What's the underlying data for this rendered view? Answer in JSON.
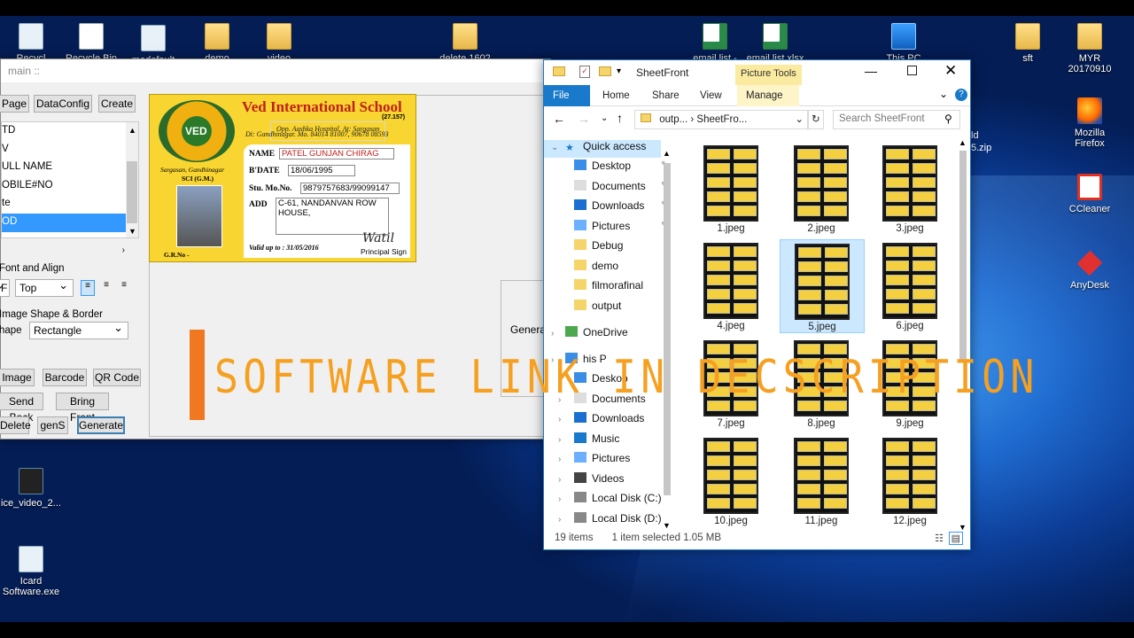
{
  "desktop": {
    "icons": [
      {
        "label": "Recycl",
        "type": "app"
      },
      {
        "label": "Recycle Bin",
        "type": "file"
      },
      {
        "label": "madefault",
        "type": "app"
      },
      {
        "label": "demo",
        "type": "fold"
      },
      {
        "label": "video",
        "type": "fold"
      },
      {
        "label": "delete 1602",
        "type": "fold"
      },
      {
        "label": "email list -",
        "type": "xls"
      },
      {
        "label": "email list.xlsx",
        "type": "xls"
      },
      {
        "label": "This PC",
        "type": "pc"
      },
      {
        "label": "sft",
        "type": "fold"
      },
      {
        "label": "MYR 20170910",
        "type": "fold"
      },
      {
        "label": "Mozilla Firefox",
        "type": "ff"
      },
      {
        "label": "CCleaner",
        "type": "cc"
      },
      {
        "label": "AnyDesk",
        "type": "ad"
      },
      {
        "label": "ice_video_2...",
        "type": "vid"
      },
      {
        "label": "Icard Software.exe",
        "type": "app"
      }
    ],
    "partial_label": "ld 5.zip"
  },
  "app": {
    "title": "main ::",
    "buttons": {
      "page": "Page",
      "dataconfig": "DataConfig",
      "create": "Create",
      "image": "Image",
      "barcode": "Barcode",
      "qrcode": "QR Code",
      "sendback": "Send Back",
      "bringfront": "Bring Front",
      "delete": "Delete",
      "gens": "genS",
      "generate": "Generate"
    },
    "list": [
      "TD",
      "V",
      "ULL NAME",
      "OBILE#NO",
      "te",
      "OD"
    ],
    "font_align": {
      "label": "Font and Align",
      "combo_left": "F",
      "combo_value": "Top"
    },
    "shape": {
      "group_label": "Image Shape & Border",
      "label": "hape",
      "value": "Rectangle"
    },
    "popup_text": "Genera"
  },
  "card": {
    "school": "Ved International School",
    "school_no": "(27.157)",
    "addr1": "Opp. Aashka Hospital, At: Sargasan",
    "addr2": "Di: Gandhinagar. Mo. 84014 81007, 90678 08593",
    "logo_text": "VED",
    "place": "Sargasan, Gandhinagar",
    "standard": "SCI (G.M.)",
    "name_label": "NAME",
    "name": "PATEL GUNJAN CHIRAG",
    "bdate_label": "B'DATE",
    "bdate": "18/06/1995",
    "mob_label": "Stu. Mo.No.",
    "mob": "9879757683/99099147",
    "add_label": "ADD",
    "add": "C-61, NANDANVAN ROW HOUSE,",
    "valid": "Valid up to : 31/05/2016",
    "sign_label": "Principal Sign",
    "signature": "Watil",
    "grno": "G.R.No -"
  },
  "explorer": {
    "title": "SheetFront",
    "context_tab": "Picture Tools",
    "tabs": [
      "File",
      "Home",
      "Share",
      "View",
      "Manage"
    ],
    "path": [
      "outp...",
      "SheetFro..."
    ],
    "search_placeholder": "Search SheetFront",
    "nav": [
      {
        "label": "Quick access",
        "level": 0,
        "icon": "star-icon"
      },
      {
        "label": "Desktop",
        "level": 1,
        "icon": "desktop-icon",
        "pin": true
      },
      {
        "label": "Documents",
        "level": 1,
        "icon": "documents-icon",
        "pin": true
      },
      {
        "label": "Downloads",
        "level": 1,
        "icon": "download-icon",
        "pin": true
      },
      {
        "label": "Pictures",
        "level": 1,
        "icon": "pictures-icon",
        "pin": true
      },
      {
        "label": "Debug",
        "level": 1,
        "icon": "folder-icon"
      },
      {
        "label": "demo",
        "level": 1,
        "icon": "folder-icon"
      },
      {
        "label": "filmorafinal",
        "level": 1,
        "icon": "folder-icon"
      },
      {
        "label": "output",
        "level": 1,
        "icon": "folder-icon"
      },
      {
        "label": "OneDrive",
        "level": 0,
        "icon": "onedrive-icon"
      },
      {
        "label": "his P",
        "level": 0,
        "icon": "pc-icon"
      },
      {
        "label": "Deskop",
        "level": 1,
        "icon": "desktop-icon"
      },
      {
        "label": "Documents",
        "level": 1,
        "icon": "documents-icon"
      },
      {
        "label": "Downloads",
        "level": 1,
        "icon": "download-icon"
      },
      {
        "label": "Music",
        "level": 1,
        "icon": "music-icon"
      },
      {
        "label": "Pictures",
        "level": 1,
        "icon": "pictures-icon"
      },
      {
        "label": "Videos",
        "level": 1,
        "icon": "videos-icon"
      },
      {
        "label": "Local Disk (C:)",
        "level": 1,
        "icon": "disk-icon"
      },
      {
        "label": "Local Disk (D:)",
        "level": 1,
        "icon": "disk-icon"
      }
    ],
    "files": [
      "1.jpeg",
      "2.jpeg",
      "3.jpeg",
      "4.jpeg",
      "5.jpeg",
      "6.jpeg",
      "7.jpeg",
      "8.jpeg",
      "9.jpeg",
      "10.jpeg",
      "11.jpeg",
      "12.jpeg"
    ],
    "selected_file": "5.jpeg",
    "status": {
      "count": "19 items",
      "selection": "1 item selected  1.05 MB"
    }
  },
  "banner": {
    "text": "SOFTWARE LINK IN DECSCRIPTION"
  }
}
